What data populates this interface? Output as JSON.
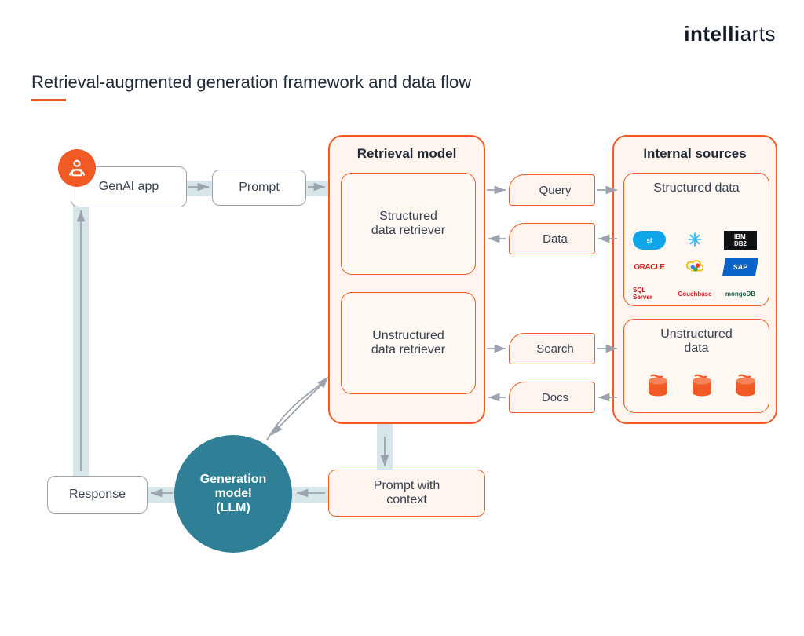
{
  "brand": {
    "bold": "intelli",
    "light": "arts"
  },
  "title": "Retrieval-augmented generation framework and data flow",
  "nodes": {
    "genai_app": "GenAI app",
    "prompt": "Prompt",
    "prompt_context": "Prompt with\ncontext",
    "response": "Response",
    "generation_model": "Generation\nmodel\n(LLM)"
  },
  "retrieval": {
    "title": "Retrieval model",
    "structured": "Structured\ndata retriever",
    "unstructured": "Unstructured\ndata retriever"
  },
  "sources": {
    "title": "Internal sources",
    "structured": "Structured data",
    "unstructured": "Unstructured\ndata"
  },
  "chips": {
    "query": "Query",
    "data": "Data",
    "search": "Search",
    "docs": "Docs"
  },
  "vendors": [
    "salesforce",
    "snowflake",
    "IBM DB2",
    "ORACLE",
    "Google Cloud",
    "SAP",
    "SQL Server",
    "Couchbase",
    "mongoDB"
  ],
  "colors": {
    "accent": "#f15a24",
    "flow": "#d6e6ea",
    "teal": "#2f7f97"
  }
}
